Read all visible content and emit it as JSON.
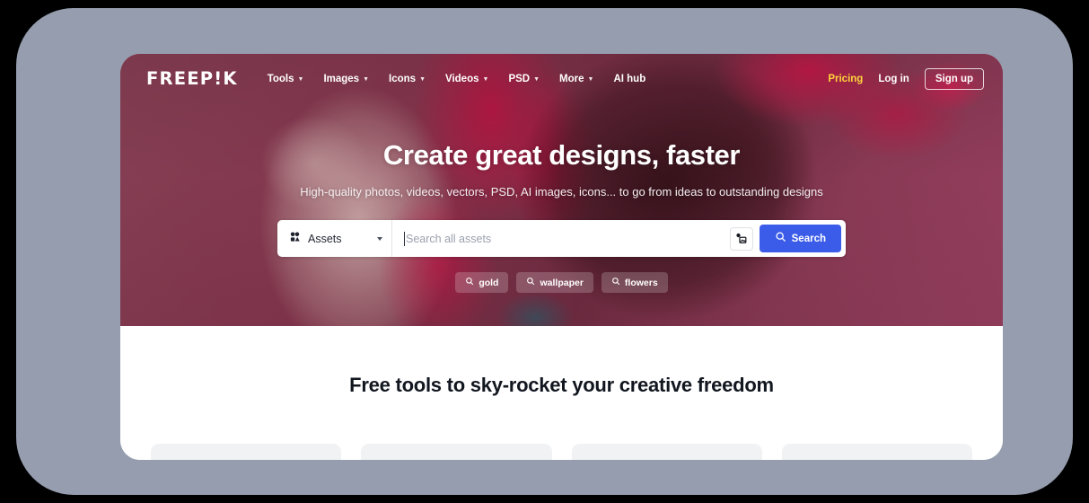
{
  "window": {
    "frame_color": "#959dae",
    "background_color": "#000000"
  },
  "header": {
    "logo": "FREEP!K",
    "nav_items": [
      {
        "label": "Tools",
        "icon": "chevron-down-icon",
        "has_chevron": true
      },
      {
        "label": "Images",
        "icon": "chevron-down-icon",
        "has_chevron": true
      },
      {
        "label": "Icons",
        "icon": "chevron-down-icon",
        "has_chevron": true
      },
      {
        "label": "Videos",
        "icon": "chevron-down-icon",
        "has_chevron": true
      },
      {
        "label": "PSD",
        "icon": "chevron-down-icon",
        "has_chevron": true
      },
      {
        "label": "More",
        "icon": "chevron-down-icon",
        "has_chevron": true
      },
      {
        "label": "AI hub",
        "icon": "",
        "has_chevron": false
      }
    ],
    "pricing_label": "Pricing",
    "pricing_color": "#ffd43b",
    "login_label": "Log in",
    "signup_label": "Sign up"
  },
  "hero": {
    "title": "Create great designs, faster",
    "subtitle": "High-quality photos, videos, vectors, PSD, AI images, icons... to go from ideas to outstanding designs",
    "background_description": "portrait photo with crimson paint splash"
  },
  "search": {
    "assets_icon": "assets-shapes-icon",
    "assets_label": "Assets",
    "caret_icon": "caret-down-icon",
    "placeholder": "Search all assets",
    "value": "",
    "image_search_icon": "image-search-icon",
    "search_icon": "search-icon",
    "search_label": "Search",
    "search_button_color": "#3b5ce8"
  },
  "suggestions": {
    "chips": [
      {
        "icon": "search-icon",
        "label": "gold"
      },
      {
        "icon": "search-icon",
        "label": "wallpaper"
      },
      {
        "icon": "search-icon",
        "label": "flowers"
      }
    ]
  },
  "body": {
    "tools_heading": "Free tools to sky-rocket your creative freedom",
    "skeleton_card_count": 4
  }
}
